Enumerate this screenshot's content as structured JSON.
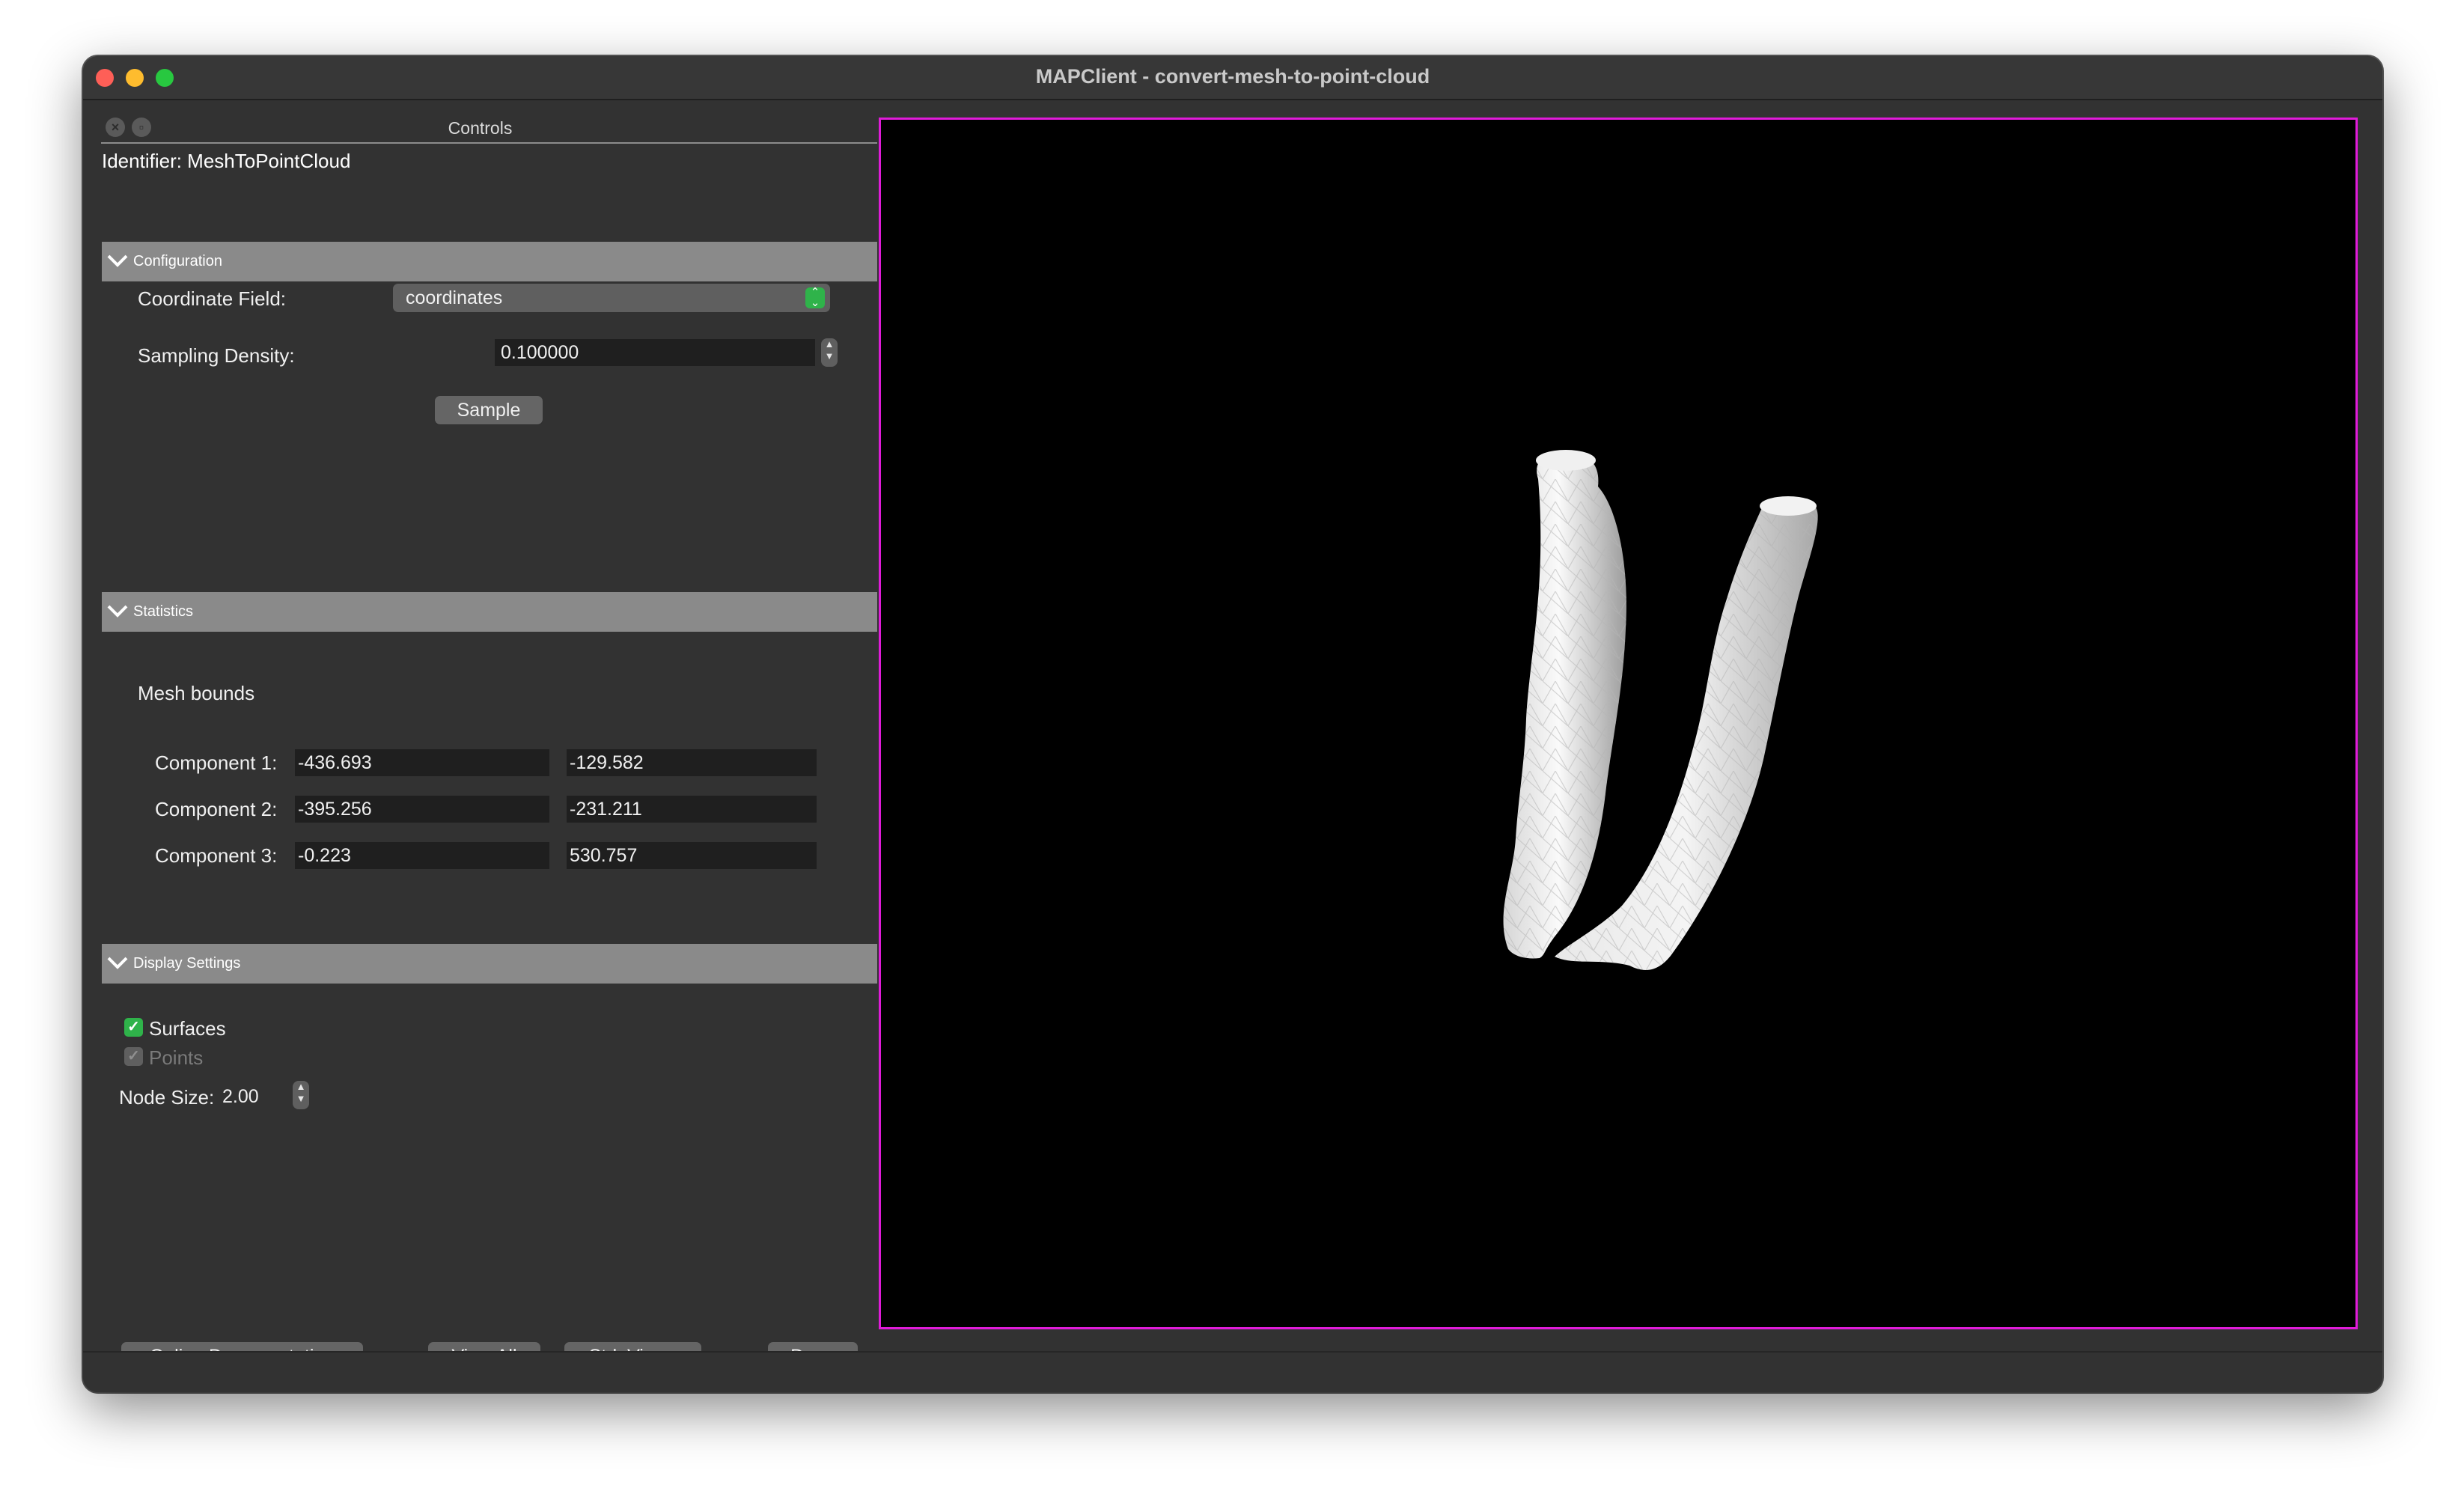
{
  "window": {
    "title": "MAPClient - convert-mesh-to-point-cloud"
  },
  "controls": {
    "title": "Controls",
    "identifier": "Identifier: MeshToPointCloud"
  },
  "configuration": {
    "header": "Configuration",
    "coordinate_field_label": "Coordinate Field:",
    "coordinate_field_value": "coordinates",
    "sampling_density_label": "Sampling Density:",
    "sampling_density_value": "0.100000",
    "sample_button": "Sample"
  },
  "statistics": {
    "header": "Statistics",
    "mesh_bounds_label": "Mesh bounds",
    "components": [
      {
        "label": "Component 1:",
        "min": "-436.693",
        "max": "-129.582"
      },
      {
        "label": "Component 2:",
        "min": "-395.256",
        "max": "-231.211"
      },
      {
        "label": "Component 3:",
        "min": "-0.223",
        "max": "530.757"
      }
    ]
  },
  "display_settings": {
    "header": "Display Settings",
    "surfaces_label": "Surfaces",
    "surfaces_checked": true,
    "points_label": "Points",
    "points_checked": true,
    "points_enabled": false,
    "node_size_label": "Node Size:",
    "node_size_value": "2.00"
  },
  "buttons": {
    "online_documentation": "Online Documentation",
    "view_all": "View All",
    "std_views": "Std. Views",
    "done": "Done"
  },
  "viewer": {
    "border_color": "#e01bd9",
    "background": "#000000",
    "model": "white mesh, two tube-like vessels"
  },
  "icons": {
    "close": "close-icon",
    "float": "float-icon",
    "chevron": "chevron-down-icon",
    "checkmark": "checkmark-icon",
    "stepper": "stepper-icon"
  },
  "colors": {
    "accent_green": "#2fb34a",
    "viewer_border": "#e01bd9",
    "section_header": "#8a8a8a"
  }
}
